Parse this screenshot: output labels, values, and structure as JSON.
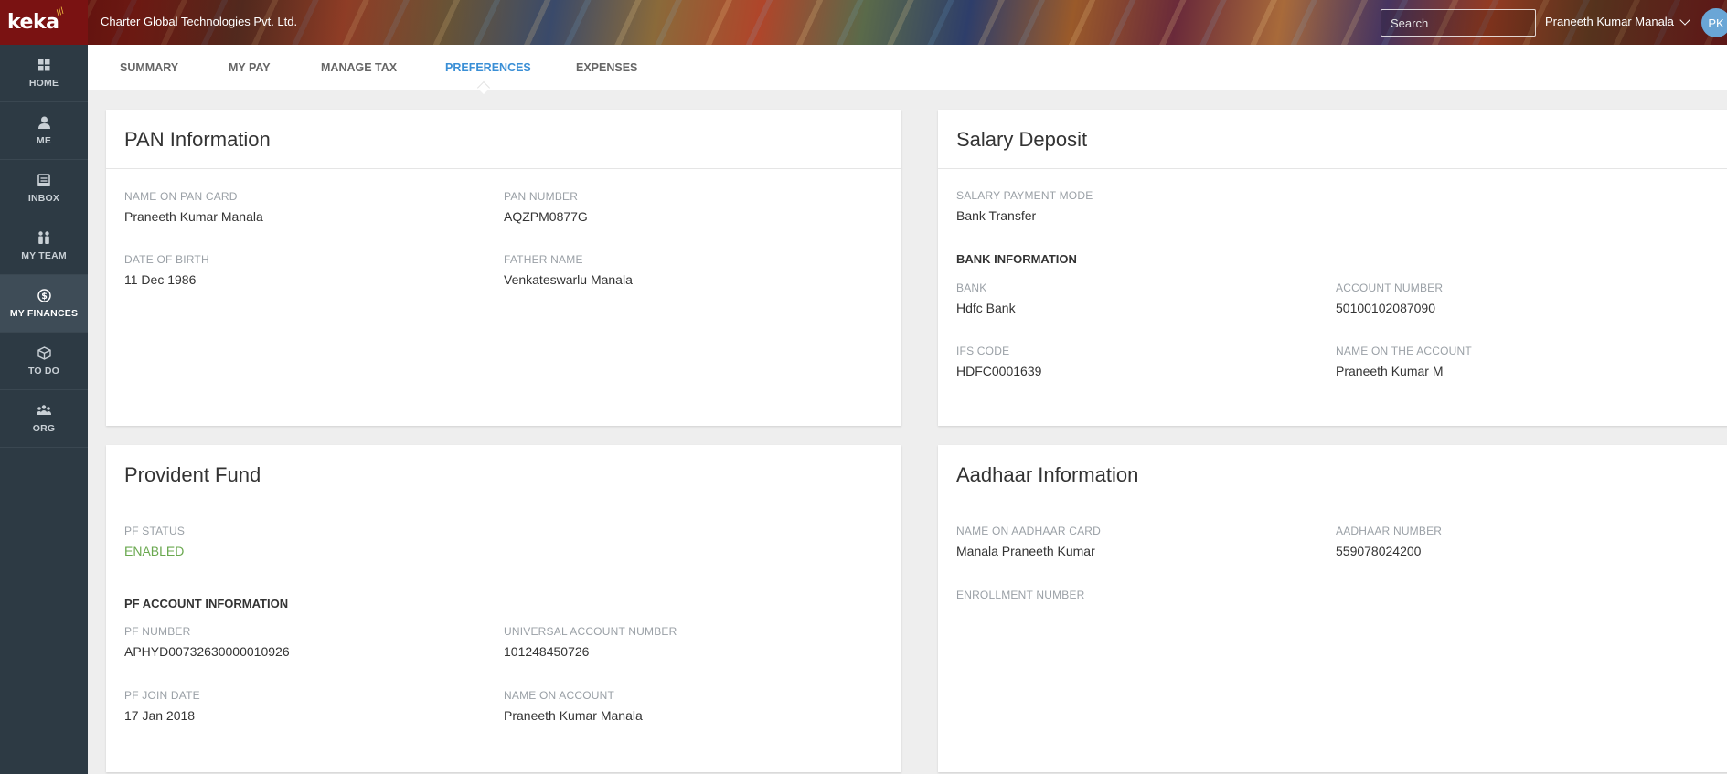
{
  "app": {
    "logo": "keka",
    "company": "Charter Global Technologies Pvt. Ltd.",
    "search_placeholder": "Search",
    "user_name": "Praneeth Kumar Manala",
    "user_initials": "PK"
  },
  "sidebar": {
    "items": [
      {
        "label": "HOME",
        "icon": "home-grid-icon"
      },
      {
        "label": "ME",
        "icon": "person-icon"
      },
      {
        "label": "INBOX",
        "icon": "inbox-icon"
      },
      {
        "label": "MY TEAM",
        "icon": "team-icon"
      },
      {
        "label": "MY FINANCES",
        "icon": "dollar-icon",
        "active": true
      },
      {
        "label": "TO DO",
        "icon": "box-icon"
      },
      {
        "label": "ORG",
        "icon": "org-icon"
      }
    ]
  },
  "tabs": [
    {
      "label": "SUMMARY"
    },
    {
      "label": "MY PAY"
    },
    {
      "label": "MANAGE TAX"
    },
    {
      "label": "PREFERENCES",
      "active": true
    },
    {
      "label": "EXPENSES"
    }
  ],
  "pan": {
    "title": "PAN Information",
    "name_label": "NAME ON PAN CARD",
    "name_value": "Praneeth Kumar Manala",
    "number_label": "PAN NUMBER",
    "number_value": "AQZPM0877G",
    "dob_label": "DATE OF BIRTH",
    "dob_value": "11 Dec 1986",
    "father_label": "FATHER NAME",
    "father_value": "Venkateswarlu Manala"
  },
  "salary": {
    "title": "Salary Deposit",
    "mode_label": "SALARY PAYMENT MODE",
    "mode_value": "Bank Transfer",
    "bank_section": "BANK INFORMATION",
    "bank_label": "BANK",
    "bank_value": "Hdfc Bank",
    "account_label": "ACCOUNT NUMBER",
    "account_value": "50100102087090",
    "ifs_label": "IFS CODE",
    "ifs_value": "HDFC0001639",
    "acc_name_label": "NAME ON THE ACCOUNT",
    "acc_name_value": "Praneeth Kumar M"
  },
  "pf": {
    "title": "Provident Fund",
    "status_label": "PF STATUS",
    "status_value": "ENABLED",
    "section": "PF ACCOUNT INFORMATION",
    "number_label": "PF NUMBER",
    "number_value": "APHYD00732630000010926",
    "uan_label": "UNIVERSAL ACCOUNT NUMBER",
    "uan_value": "101248450726",
    "join_label": "PF JOIN DATE",
    "join_value": "17 Jan 2018",
    "name_label": "NAME ON ACCOUNT",
    "name_value": "Praneeth Kumar Manala"
  },
  "aadhaar": {
    "title": "Aadhaar Information",
    "name_label": "NAME ON AADHAAR CARD",
    "name_value": "Manala Praneeth Kumar",
    "number_label": "AADHAAR NUMBER",
    "number_value": "559078024200",
    "enroll_label": "ENROLLMENT NUMBER"
  },
  "colors": {
    "accent": "#3a8fd6",
    "sidebar_bg": "#2d3a44",
    "enabled_green": "#6aa84f"
  }
}
